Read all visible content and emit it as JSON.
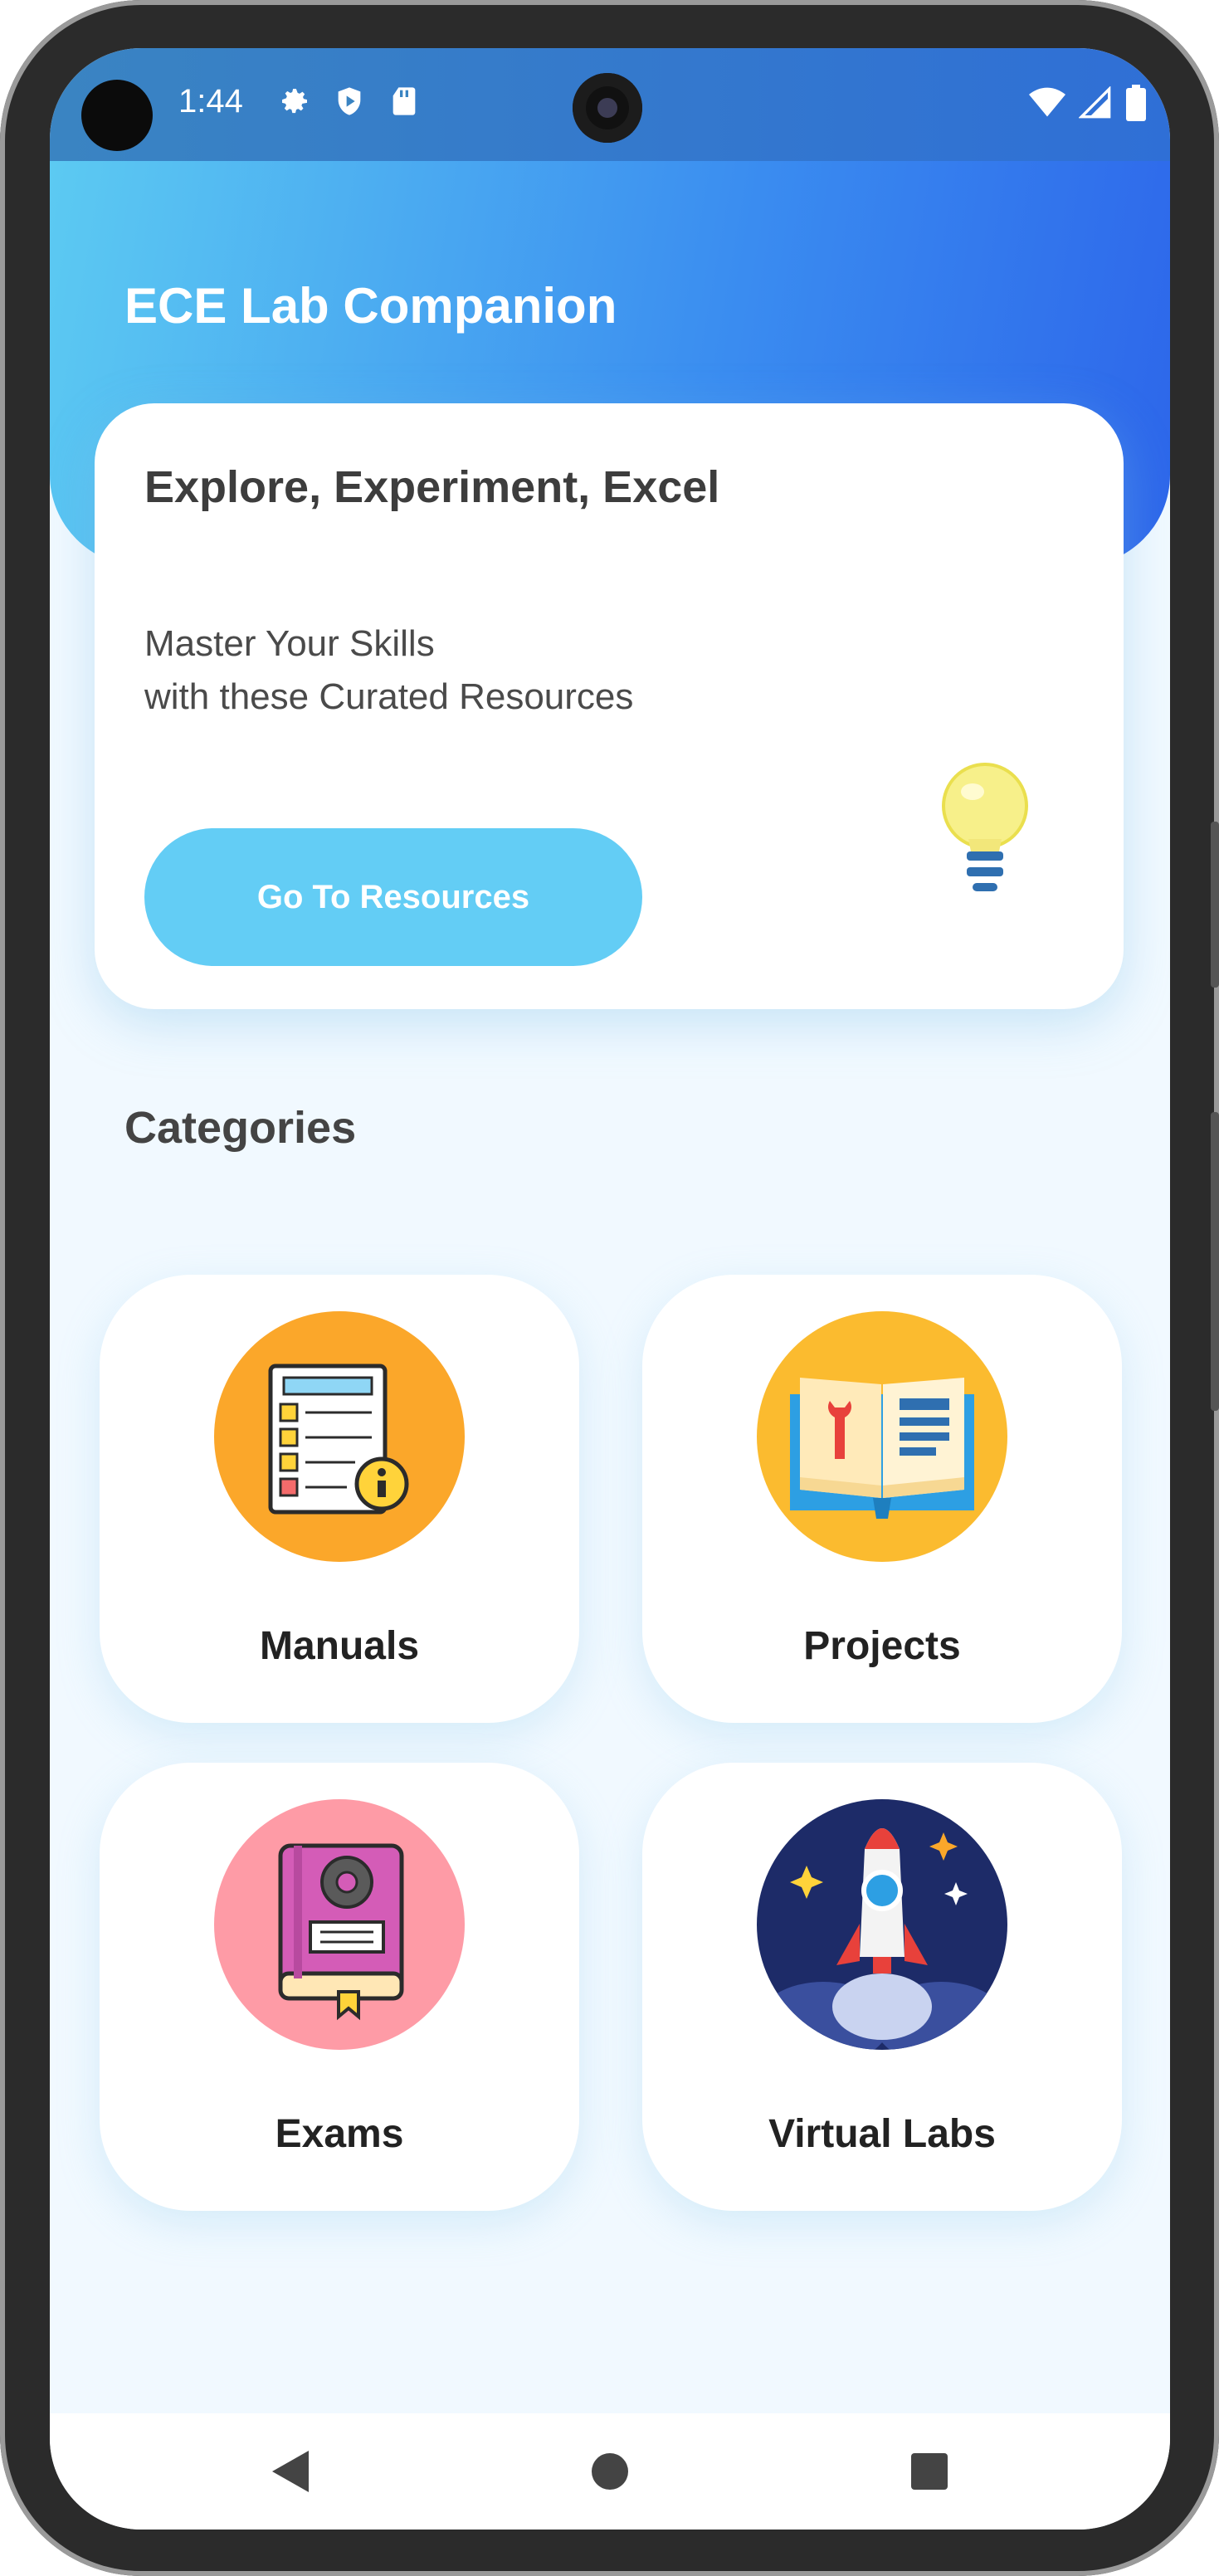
{
  "status_bar": {
    "time": "1:44"
  },
  "header": {
    "app_title": "ECE Lab Companion"
  },
  "hero": {
    "title": "Explore, Experiment, Excel",
    "subtitle_line1": "Master Your Skills",
    "subtitle_line2": "with these Curated Resources",
    "button_label": "Go To Resources"
  },
  "categories": {
    "title": "Categories",
    "items": [
      {
        "label": "Manuals",
        "icon": "manual-checklist-icon",
        "color": "#fba72a"
      },
      {
        "label": "Projects",
        "icon": "open-book-tools-icon",
        "color": "#fbbb2f"
      },
      {
        "label": "Exams",
        "icon": "book-gear-icon",
        "color": "#fe9ba6"
      },
      {
        "label": "Virtual Labs",
        "icon": "rocket-icon",
        "color": "#1d2b68"
      }
    ]
  },
  "colors": {
    "header_gradient_start": "#5ccaf2",
    "header_gradient_end": "#2d66ea",
    "button": "#63cdf5",
    "background": "#f1f9ff"
  }
}
